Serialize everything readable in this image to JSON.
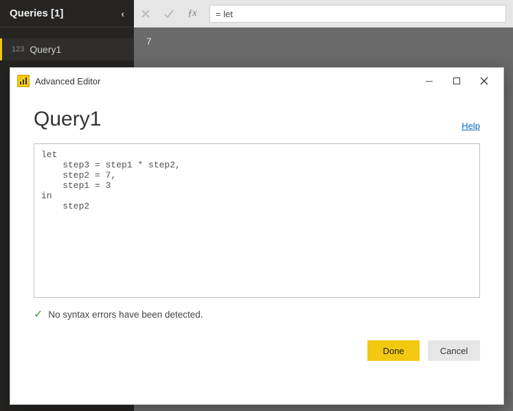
{
  "queriesPanel": {
    "title": "Queries [1]",
    "item": {
      "index": "123",
      "name": "Query1"
    }
  },
  "formulaBar": {
    "value": "= let"
  },
  "grid": {
    "cell": "7"
  },
  "dialog": {
    "title": "Advanced Editor",
    "heading": "Query1",
    "helpLabel": "Help",
    "code": "let\n    step3 = step1 * step2,\n    step2 = 7,\n    step1 = 3\nin\n    step2",
    "status": "No syntax errors have been detected.",
    "doneLabel": "Done",
    "cancelLabel": "Cancel"
  }
}
